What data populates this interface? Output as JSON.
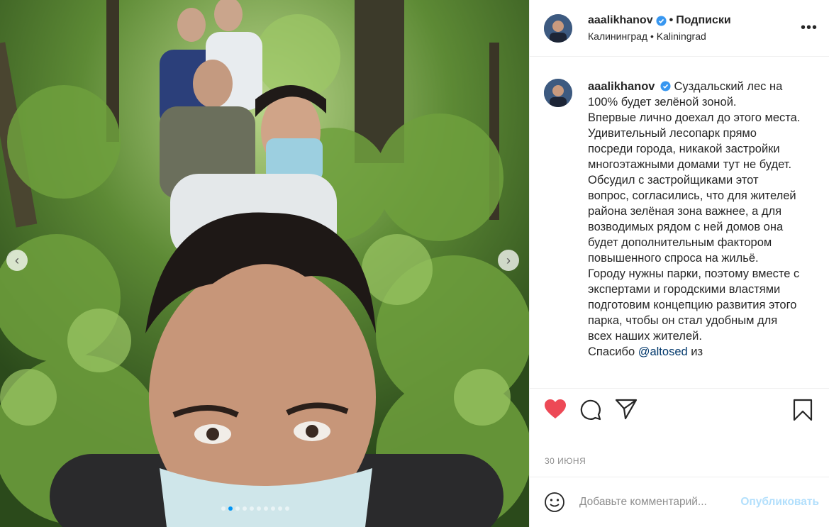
{
  "post": {
    "username": "aaalikhanov",
    "follow_separator": "•",
    "follow_label": "Подписки",
    "location": "Калининград • Kaliningrad",
    "more_label": "•••",
    "caption_text": "Суздальский лес на 100% будет зелёной зоной.\nВпервые лично доехал до этого места. Удивительный лесопарк прямо посреди города, никакой застройки многоэтажными домами тут не будет.\nОбсудил с застройщиками этот вопрос, согласились, что для жителей района зелёная зона важнее, а для возводимых рядом с ней домов она будет дополнительным фактором повышенного спроса на жильё.\nГороду нужны парки, поэтому вместе с экспертами и городскими властями подготовим концепцию развития этого парка, чтобы он стал удобным для всех наших жителей.\nСпасибо ",
    "caption_mention": "@altosed",
    "caption_tail": " из",
    "date": "30 ИЮНЯ",
    "liked": true
  },
  "comment": {
    "placeholder": "Добавьте комментарий...",
    "publish_label": "Опубликовать"
  },
  "carousel": {
    "prev_icon": "‹",
    "next_icon": "›",
    "slide_count": 10,
    "active_index": 1
  },
  "colors": {
    "like_red": "#ed4956",
    "verified_blue": "#3897f0",
    "publish_disabled": "#b2dffc"
  }
}
